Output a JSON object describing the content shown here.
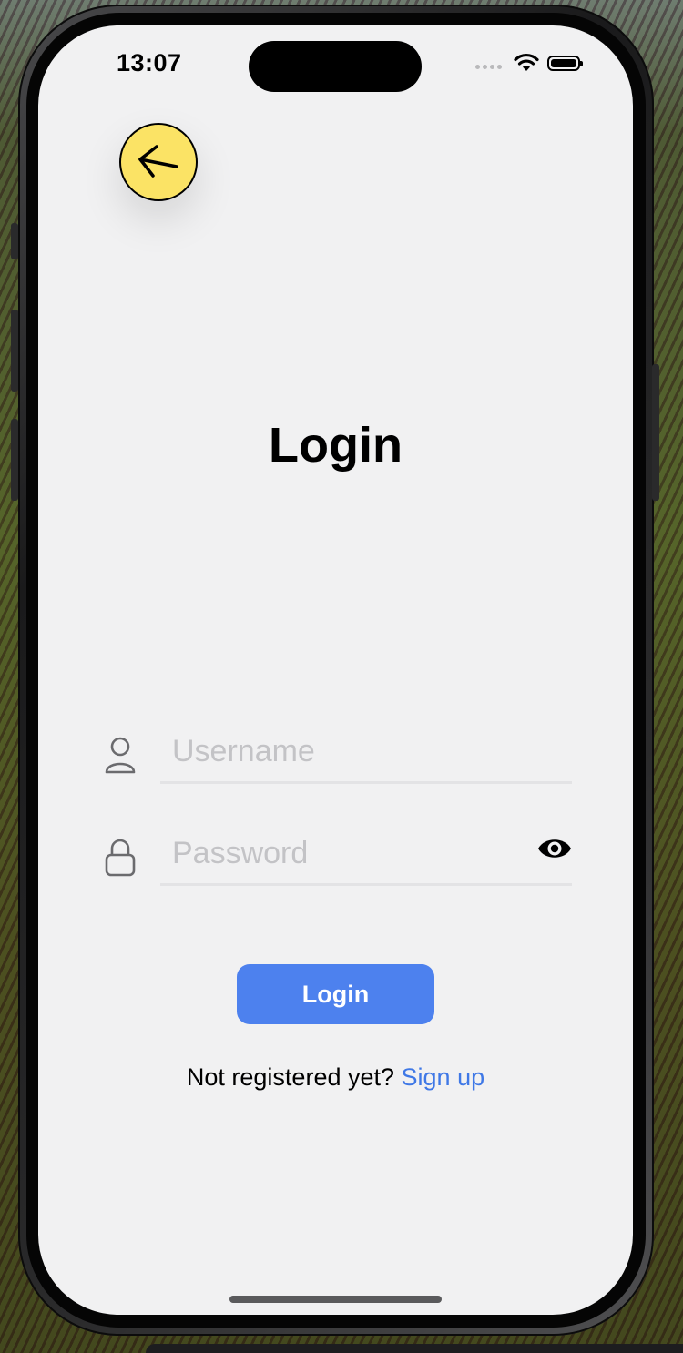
{
  "status_bar": {
    "time": "13:07"
  },
  "screen": {
    "back_button_icon": "arrow-left-icon",
    "title": "Login"
  },
  "form": {
    "username_placeholder": "Username",
    "username_value": "",
    "password_placeholder": "Password",
    "password_value": "",
    "login_label": "Login",
    "signup_prompt": "Not registered yet?",
    "signup_link": "Sign up"
  },
  "colors": {
    "back_button": "#fbe365",
    "primary": "#4d81ee",
    "link": "#3f78e6",
    "background": "#f1f1f2"
  }
}
